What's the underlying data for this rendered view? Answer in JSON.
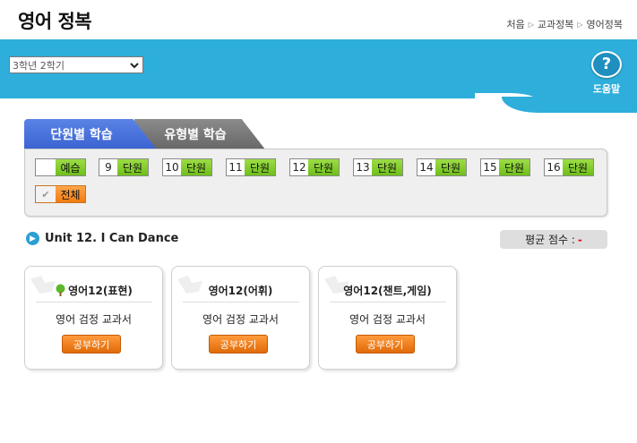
{
  "header": {
    "title": "영어 정복",
    "breadcrumb": [
      "처음",
      "교과정복",
      "영어정복"
    ]
  },
  "toolbar": {
    "semester_value": "3학년 2학기",
    "help_label": "도움말",
    "help_glyph": "?"
  },
  "tabs": {
    "unit": "단원별 학습",
    "type": "유형별 학습"
  },
  "units": {
    "preview_label": "예습",
    "all_label": "전체",
    "unit_label": "단원",
    "numbers": [
      "9",
      "10",
      "11",
      "12",
      "13",
      "14",
      "15",
      "16"
    ]
  },
  "lesson": {
    "title": "Unit 12. I Can Dance",
    "score_label": "평균 점수 :",
    "score_value": "-"
  },
  "cards": [
    {
      "title": "영어12(표현)",
      "subtitle": "영어 검정 교과서",
      "button": "공부하기"
    },
    {
      "title": "영어12(어휘)",
      "subtitle": "영어 검정 교과서",
      "button": "공부하기"
    },
    {
      "title": "영어12(챈트,게임)",
      "subtitle": "영어 검정 교과서",
      "button": "공부하기"
    }
  ],
  "colors": {
    "band": "#2eaedb",
    "tab_active": "#3a63d1",
    "tab_inactive": "#676767",
    "unit_label_green": "#6fbf1a",
    "all_orange": "#f07c10",
    "study_button": "#e06a08",
    "score_value": "#e01010"
  },
  "icons": [
    "chevron-down-icon",
    "help-icon",
    "play-bullet-icon",
    "tree-icon",
    "check-icon",
    "triangle-separator-icon"
  ]
}
